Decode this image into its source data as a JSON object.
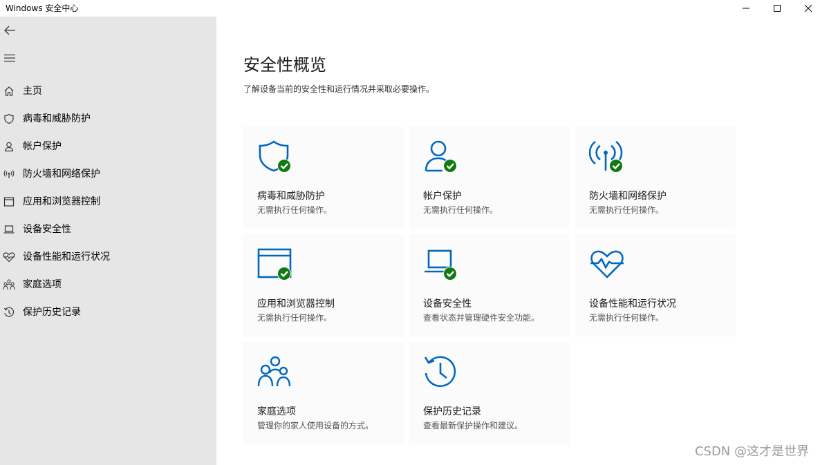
{
  "window": {
    "title": "Windows 安全中心"
  },
  "sidebar": {
    "back_icon": "back-arrow-icon",
    "menu_icon": "hamburger-menu-icon",
    "items": [
      {
        "label": "主页",
        "icon": "home-icon"
      },
      {
        "label": "病毒和威胁防护",
        "icon": "shield-icon"
      },
      {
        "label": "帐户保护",
        "icon": "person-icon"
      },
      {
        "label": "防火墙和网络保护",
        "icon": "wireless-signal-icon"
      },
      {
        "label": "应用和浏览器控制",
        "icon": "browser-window-icon"
      },
      {
        "label": "设备安全性",
        "icon": "laptop-icon"
      },
      {
        "label": "设备性能和运行状况",
        "icon": "heart-pulse-icon"
      },
      {
        "label": "家庭选项",
        "icon": "family-icon"
      },
      {
        "label": "保护历史记录",
        "icon": "history-icon"
      }
    ]
  },
  "main": {
    "title": "安全性概览",
    "subtitle": "了解设备当前的安全性和运行情况并采取必要操作。",
    "cards": [
      {
        "title": "病毒和威胁防护",
        "desc": "无需执行任何操作。",
        "icon": "shield-icon",
        "status": "ok"
      },
      {
        "title": "帐户保护",
        "desc": "无需执行任何操作。",
        "icon": "person-icon",
        "status": "ok"
      },
      {
        "title": "防火墙和网络保护",
        "desc": "无需执行任何操作。",
        "icon": "wireless-signal-icon",
        "status": "ok"
      },
      {
        "title": "应用和浏览器控制",
        "desc": "无需执行任何操作。",
        "icon": "browser-window-icon",
        "status": "ok"
      },
      {
        "title": "设备安全性",
        "desc": "查看状态并管理硬件安全功能。",
        "icon": "laptop-icon",
        "status": "ok"
      },
      {
        "title": "设备性能和运行状况",
        "desc": "无需执行任何操作。",
        "icon": "heart-pulse-icon",
        "status": "none"
      },
      {
        "title": "家庭选项",
        "desc": "管理你的家人使用设备的方式。",
        "icon": "family-icon",
        "status": "none"
      },
      {
        "title": "保护历史记录",
        "desc": "查看最新保护操作和建议。",
        "icon": "history-icon",
        "status": "none"
      }
    ]
  },
  "watermark": "CSDN @这才是世界",
  "colors": {
    "accent_blue": "#0067c0",
    "ok_green": "#107c10",
    "sidebar_bg": "#e6e6e6",
    "card_bg": "#fbfbfb"
  }
}
